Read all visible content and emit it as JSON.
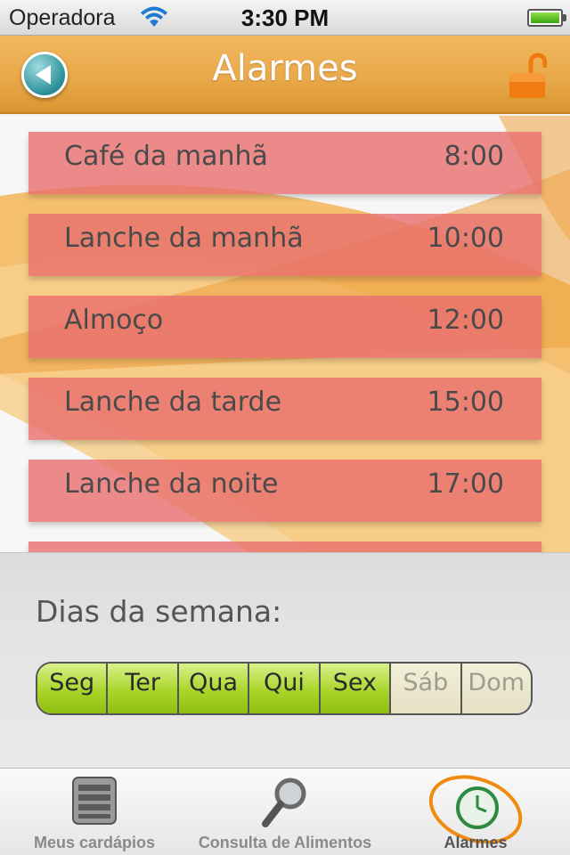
{
  "status_bar": {
    "carrier": "Operadora",
    "time": "3:30 PM",
    "wifi_icon": "wifi-icon",
    "battery_icon": "battery-icon"
  },
  "nav": {
    "title": "Alarmes",
    "back_icon": "back-arrow-icon",
    "lock_icon": "unlocked-padlock-icon"
  },
  "alarms": [
    {
      "name": "Café da manhã",
      "time": "8:00"
    },
    {
      "name": "Lanche da manhã",
      "time": "10:00"
    },
    {
      "name": "Almoço",
      "time": "12:00"
    },
    {
      "name": "Lanche da tarde",
      "time": "15:00"
    },
    {
      "name": "Lanche da noite",
      "time": "17:00"
    }
  ],
  "week": {
    "label": "Dias da semana:",
    "days": [
      {
        "label": "Seg",
        "active": true
      },
      {
        "label": "Ter",
        "active": true
      },
      {
        "label": "Qua",
        "active": true
      },
      {
        "label": "Qui",
        "active": true
      },
      {
        "label": "Sex",
        "active": true
      },
      {
        "label": "Sáb",
        "active": false
      },
      {
        "label": "Dom",
        "active": false
      }
    ]
  },
  "tabs": [
    {
      "label": "Meus cardápios",
      "icon": "menu-list-icon",
      "active": false
    },
    {
      "label": "Consulta de Alimentos",
      "icon": "magnifier-icon",
      "active": false
    },
    {
      "label": "Alarmes",
      "icon": "clock-icon",
      "active": true
    }
  ],
  "colors": {
    "accent_orange": "#eaa94a",
    "alarm_row": "#e86e6e",
    "day_on": "#a9d52a",
    "back_button": "#2a8f98"
  }
}
